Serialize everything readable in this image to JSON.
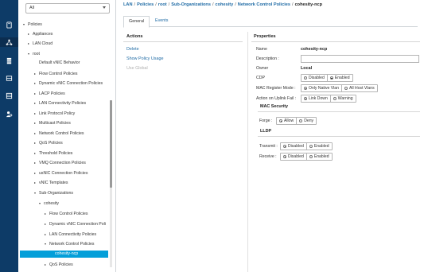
{
  "nav": {
    "icons": [
      "equipment-icon",
      "network-icon",
      "servers-icon",
      "storage-icon",
      "vm-icon",
      "admin-icon"
    ],
    "active": "network-icon"
  },
  "filter": {
    "value": "All"
  },
  "tree": {
    "items": [
      {
        "label": "Policies",
        "caret": "▾"
      },
      {
        "label": "Appliances",
        "caret": "▸"
      },
      {
        "label": "LAN Cloud",
        "caret": "▸"
      },
      {
        "label": "root",
        "caret": "▾"
      },
      {
        "label": "Default vNIC Behavior",
        "caret": ""
      },
      {
        "label": "Flow Control Policies",
        "caret": "▸"
      },
      {
        "label": "Dynamic vNIC Connection Policies",
        "caret": "▸"
      },
      {
        "label": "LACP Policies",
        "caret": "▸"
      },
      {
        "label": "LAN Connectivity Policies",
        "caret": "▸"
      },
      {
        "label": "Link Protocol Policy",
        "caret": "▸"
      },
      {
        "label": "Multicast Policies",
        "caret": "▸"
      },
      {
        "label": "Network Control Policies",
        "caret": "▸"
      },
      {
        "label": "QoS Policies",
        "caret": "▸"
      },
      {
        "label": "Threshold Policies",
        "caret": "▸"
      },
      {
        "label": "VMQ Connection Policies",
        "caret": "▸"
      },
      {
        "label": "usNIC Connection Policies",
        "caret": "▸"
      },
      {
        "label": "vNIC Templates",
        "caret": "▸"
      },
      {
        "label": "Sub-Organizations",
        "caret": "▾"
      },
      {
        "label": "cohesity",
        "caret": "▾"
      },
      {
        "label": "Flow Control Policies",
        "caret": "▸"
      },
      {
        "label": "Dynamic vNIC Connection Poli",
        "caret": "▸"
      },
      {
        "label": "LAN Connectivity Policies",
        "caret": "▸"
      },
      {
        "label": "Network Control Policies",
        "caret": "▾"
      },
      {
        "label": "cohesity-ncp",
        "caret": ""
      },
      {
        "label": "QoS Policies",
        "caret": "▸"
      }
    ]
  },
  "breadcrumb": {
    "items": [
      "LAN",
      "Policies",
      "root",
      "Sub-Organizations",
      "cohesity",
      "Network Control Policies"
    ],
    "current": "cohesity-ncp",
    "separator": "/"
  },
  "tabs": [
    "General",
    "Events"
  ],
  "actions": {
    "title": "Actions",
    "items": [
      {
        "label": "Delete",
        "enabled": true
      },
      {
        "label": "Show Policy Usage",
        "enabled": true
      },
      {
        "label": "Use Global",
        "enabled": false
      }
    ]
  },
  "properties": {
    "title": "Properties",
    "name_label": "Name",
    "name_value": "cohesity-ncp",
    "description_label": "Description :",
    "description_value": "",
    "owner_label": "Owner",
    "owner_value": "Local",
    "cdp_label": "CDP",
    "cdp_options": [
      "Disabled",
      "Enabled"
    ],
    "cdp_selected": "Enabled",
    "mac_register_label": "MAC Register Mode :",
    "mac_register_options": [
      "Only Native Vlan",
      "All Host Vlans"
    ],
    "mac_register_selected": "Only Native Vlan",
    "uplink_fail_label": "Action on Uplink Fail :",
    "uplink_fail_options": [
      "Link Down",
      "Warning"
    ],
    "uplink_fail_selected": "Link Down",
    "mac_security_title": "MAC Security",
    "forge_label": "Forge :",
    "forge_options": [
      "Allow",
      "Deny"
    ],
    "forge_selected": "Allow",
    "lldp_title": "LLDP",
    "transmit_label": "Transmit :",
    "transmit_options": [
      "Disabled",
      "Enabled"
    ],
    "transmit_selected": "Disabled",
    "receive_label": "Receive :",
    "receive_options": [
      "Disabled",
      "Enabled"
    ],
    "receive_selected": "Disabled"
  },
  "colors": {
    "nav_bg": "#0d3b67",
    "selected_bg": "#049fd9",
    "link": "#1f6ba5"
  }
}
